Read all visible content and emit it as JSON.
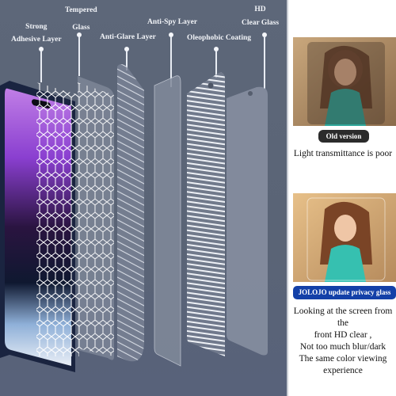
{
  "labels": {
    "adhesive": [
      "Strong",
      "Adhesive Layer"
    ],
    "tempered": [
      "Tempered",
      "Glass"
    ],
    "antiglare": [
      "Anti-Glare Layer"
    ],
    "antispy": [
      "Anti-Spy Layer"
    ],
    "oleophobic": [
      "Oleophobic Coating"
    ],
    "hdclear": [
      "HD",
      "Clear Glass"
    ]
  },
  "comparison": {
    "old": {
      "badge": "Old version",
      "badge_color": "#2b2b2b",
      "caption": "Light transmittance is poor"
    },
    "new": {
      "badge": "JOLOJO update privacy glass",
      "badge_color": "#1340a8",
      "caption_lines": [
        "Looking at the screen from the",
        "front HD clear ,",
        "Not too much blur/dark",
        "The same color viewing",
        "experience"
      ]
    }
  },
  "colors": {
    "background": "#5b6577",
    "accent_blue": "#1340a8"
  }
}
